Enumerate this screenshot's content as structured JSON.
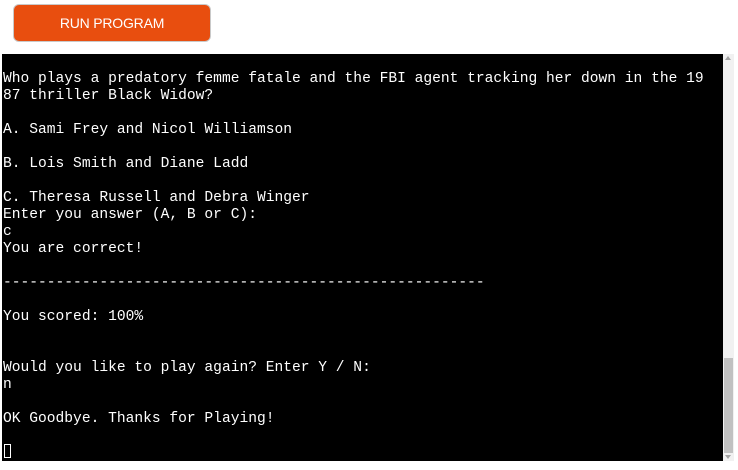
{
  "toolbar": {
    "run_label": "RUN PROGRAM"
  },
  "terminal": {
    "lines": [
      "Who plays a predatory femme fatale and the FBI agent tracking her down in the 19",
      "87 thriller Black Widow?",
      "A. Sami Frey and Nicol Williamson",
      "B. Lois Smith and Diane Ladd",
      "C. Theresa Russell and Debra Winger",
      "Enter you answer (A, B or C):",
      "c",
      "You are correct!",
      "-------------------------------------------------------",
      "You scored: 100%",
      "Would you like to play again? Enter Y / N:",
      "n",
      "OK Goodbye. Thanks for Playing!"
    ]
  },
  "colors": {
    "button_bg": "#e84e0f",
    "terminal_bg": "#000000",
    "terminal_fg": "#ffffff"
  }
}
